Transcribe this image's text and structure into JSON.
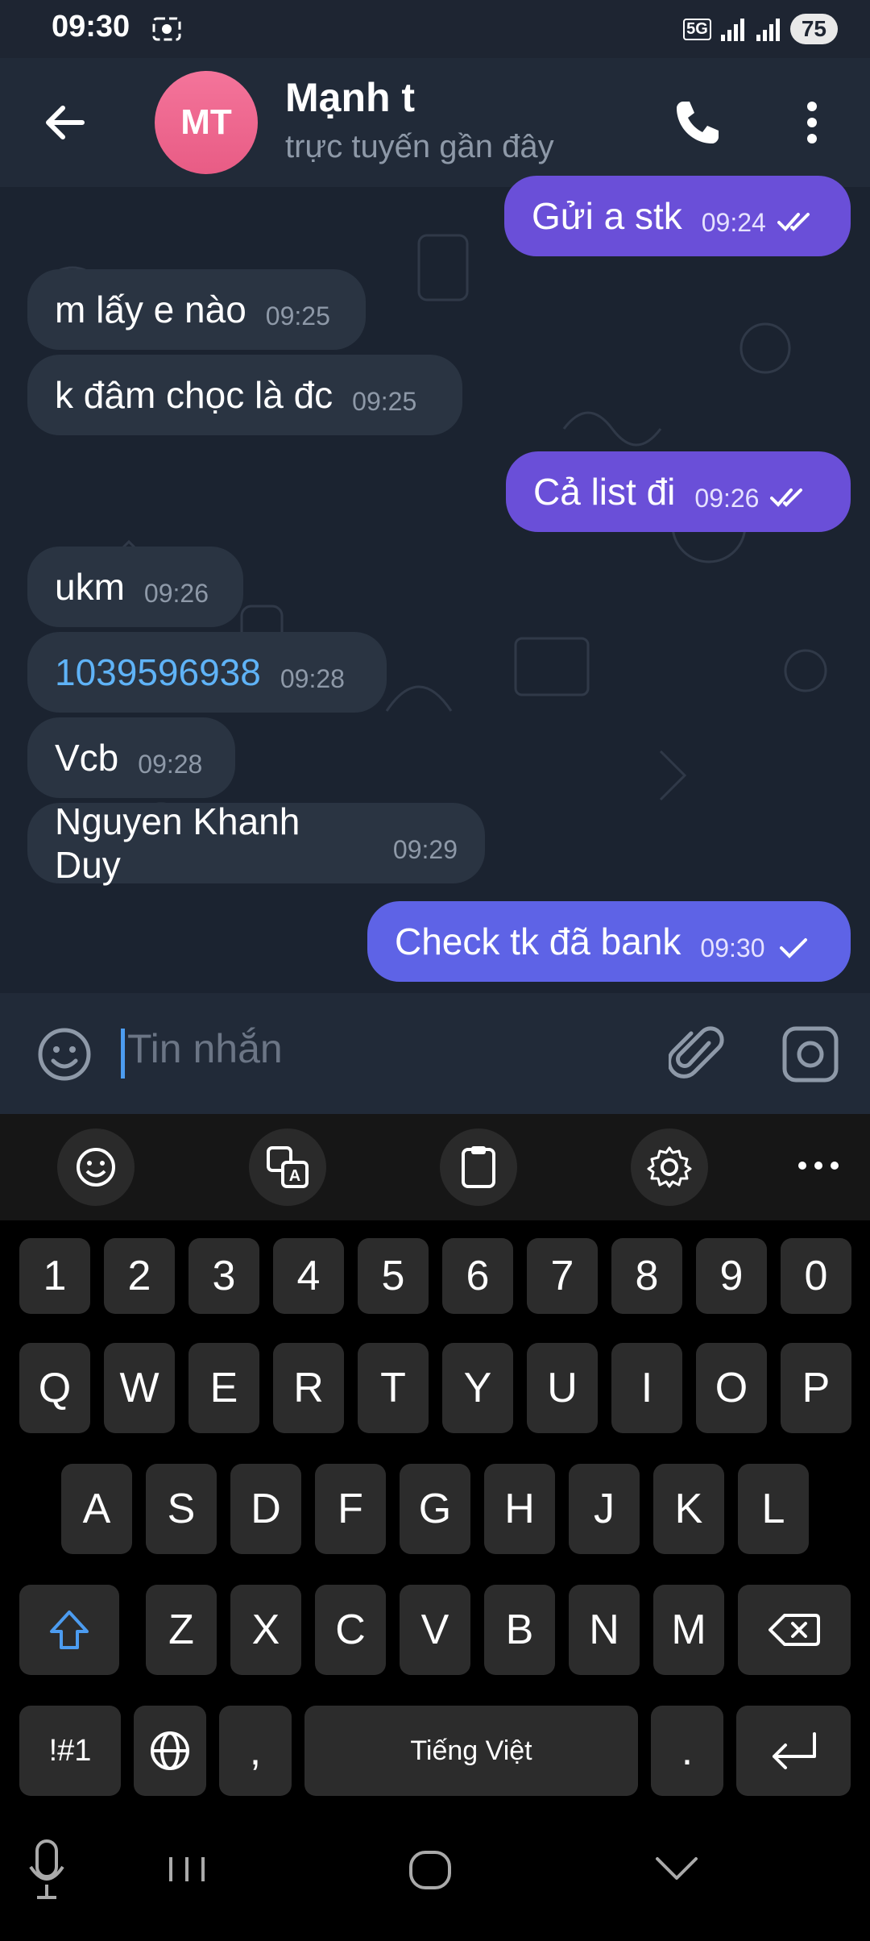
{
  "status_bar": {
    "time": "09:30",
    "network": "5G",
    "battery": "75"
  },
  "header": {
    "avatar_initials": "MT",
    "contact_name": "Mạnh t",
    "contact_status": "trực tuyến gần đây"
  },
  "messages": [
    {
      "direction": "out",
      "text": "Gửi a stk",
      "time": "09:24",
      "status": "read"
    },
    {
      "direction": "in",
      "text": "m lấy e nào",
      "time": "09:25"
    },
    {
      "direction": "in",
      "text": "k đâm chọc là đc",
      "time": "09:25"
    },
    {
      "direction": "out",
      "text": "Cả list đi",
      "time": "09:26",
      "status": "read"
    },
    {
      "direction": "in",
      "text": "ukm",
      "time": "09:26"
    },
    {
      "direction": "in",
      "text": "1039596938",
      "time": "09:28",
      "is_link": true
    },
    {
      "direction": "in",
      "text": "Vcb",
      "time": "09:28"
    },
    {
      "direction": "in",
      "text": "Nguyen Khanh Duy",
      "time": "09:29"
    },
    {
      "direction": "out",
      "text": "Check tk đã bank",
      "time": "09:30",
      "status": "sent"
    }
  ],
  "input": {
    "placeholder": "Tin nhắn"
  },
  "keyboard": {
    "number_row": [
      "1",
      "2",
      "3",
      "4",
      "5",
      "6",
      "7",
      "8",
      "9",
      "0"
    ],
    "row1": [
      "Q",
      "W",
      "E",
      "R",
      "T",
      "Y",
      "U",
      "I",
      "O",
      "P"
    ],
    "row2": [
      "A",
      "S",
      "D",
      "F",
      "G",
      "H",
      "J",
      "K",
      "L"
    ],
    "row3": [
      "Z",
      "X",
      "C",
      "V",
      "B",
      "N",
      "M"
    ],
    "symbols_label": "!#1",
    "comma": ",",
    "space_label": "Tiếng Việt",
    "period": "."
  },
  "colors": {
    "outgoing_bubble": "#6a4fd8",
    "incoming_bubble": "#2a3442",
    "link": "#5fb3f7",
    "avatar": "#e85c85"
  }
}
